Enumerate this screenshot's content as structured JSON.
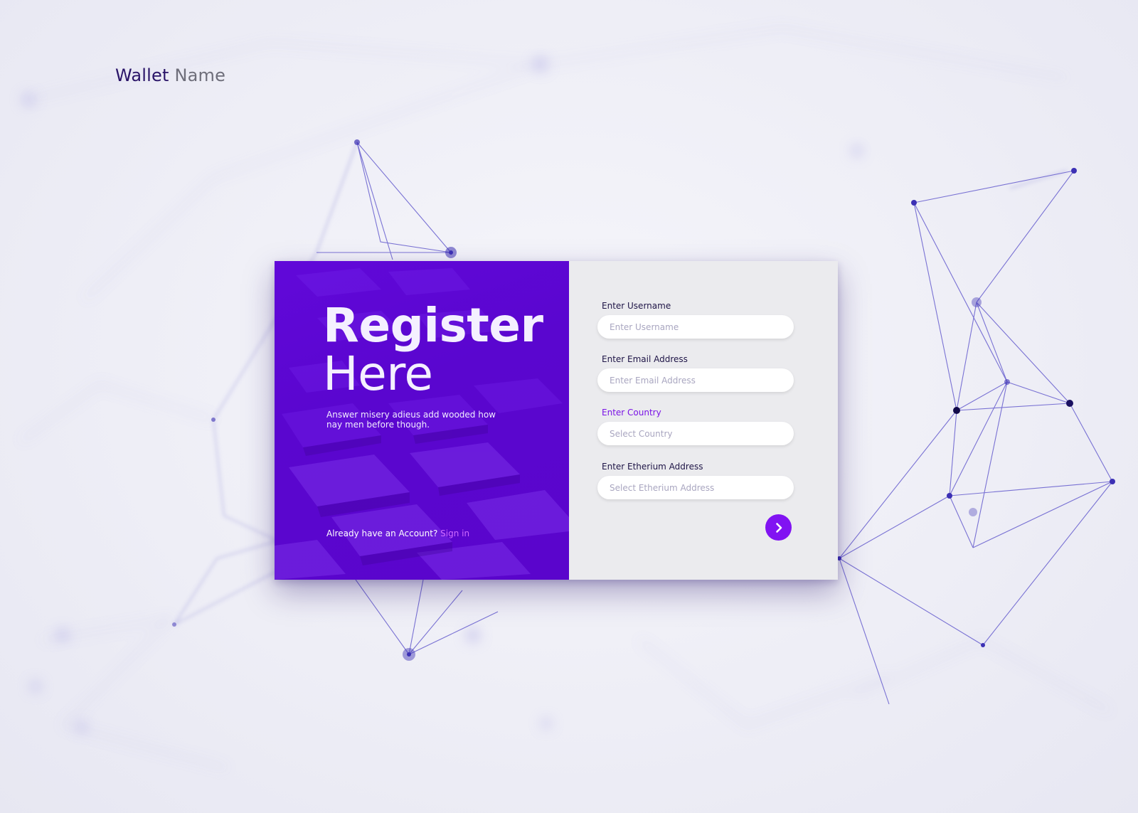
{
  "brand": {
    "word1": "Wallet",
    "word2": "Name"
  },
  "hero": {
    "title_line1": "Register",
    "title_line2": "Here",
    "tagline": "Answer misery adieus add wooded how nay men before though.",
    "signin_prompt": "Already have an Account?",
    "signin_link": "Sign in"
  },
  "form": {
    "username": {
      "label": "Enter Username",
      "placeholder": "Enter Username",
      "value": ""
    },
    "email": {
      "label": "Enter Email Address",
      "placeholder": "Enter Email Address",
      "value": ""
    },
    "country": {
      "label": "Enter Country",
      "placeholder": "Select Country",
      "value": ""
    },
    "eth": {
      "label": "Enter Etherium Address",
      "placeholder": "Select Etherium Address",
      "value": ""
    },
    "submit_icon": "chevron-right-icon"
  },
  "colors": {
    "brand_purple": "#5a06cf",
    "accent_purple": "#8113f2",
    "link_pink": "#d06bff",
    "form_bg": "#ebebee"
  }
}
